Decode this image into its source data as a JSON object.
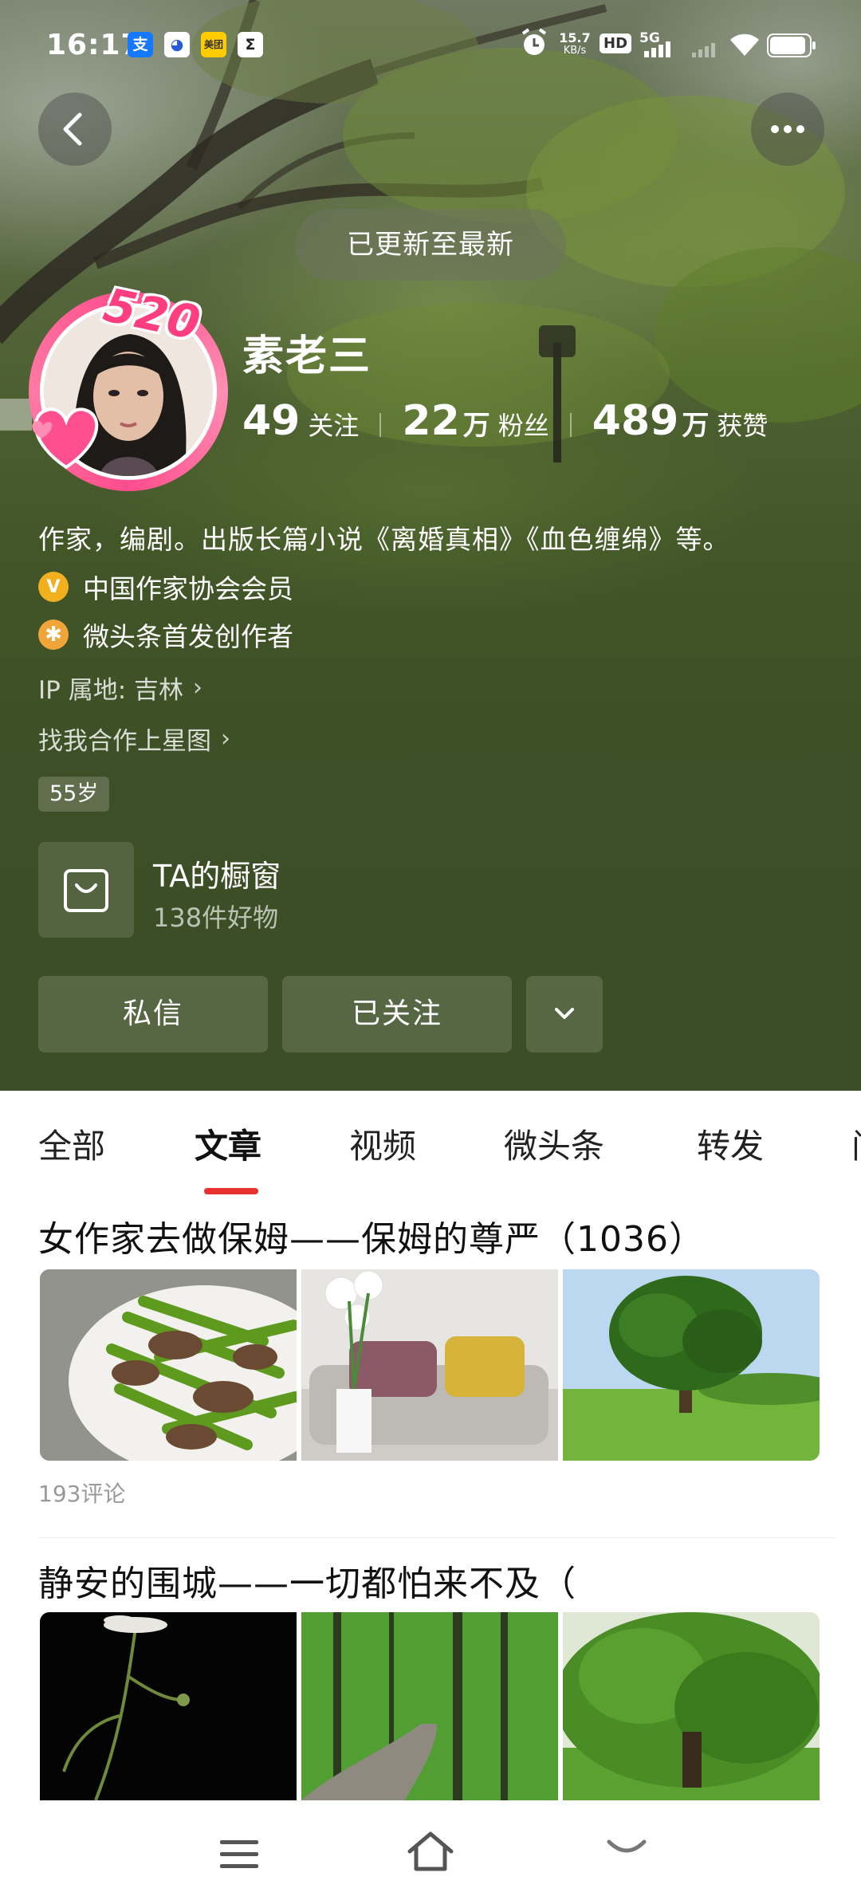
{
  "status_bar": {
    "time": "16:17",
    "app_icons": [
      "alipay-icon",
      "baidu-icon",
      "meituan-icon",
      "sigma-app-icon"
    ],
    "net_speed_value": "15.7",
    "net_speed_unit": "KB/s",
    "hd_label": "HD",
    "signal_label": "5G"
  },
  "toast": "已更新至最新",
  "profile": {
    "name": "素老三",
    "avatar_badge": "520",
    "following_count": "49",
    "following_label": "关注",
    "fans_count": "22",
    "fans_unit": "万",
    "fans_label": "粉丝",
    "likes_count": "489",
    "likes_unit": "万",
    "likes_label": "获赞",
    "bio": "作家，编剧。出版长篇小说《离婚真相》《血色缠绵》等。",
    "verified_1": "中国作家协会会员",
    "verified_2": "微头条首发创作者",
    "ip_location": "IP 属地: 吉林",
    "cooperation_link": "找我合作上星图",
    "age_tag": "55岁"
  },
  "shop": {
    "title": "TA的橱窗",
    "subtitle": "138件好物"
  },
  "actions": {
    "message": "私信",
    "follow": "已关注"
  },
  "tabs": [
    {
      "label": "全部"
    },
    {
      "label": "文章"
    },
    {
      "label": "视频"
    },
    {
      "label": "微头条"
    },
    {
      "label": "转发"
    },
    {
      "label": "问"
    }
  ],
  "active_tab": "文章",
  "articles": [
    {
      "title": "女作家去做保姆——保姆的尊严（1036）",
      "comments": "193评论"
    },
    {
      "title": "静安的围城——一切都怕来不及（"
    }
  ],
  "colors": {
    "accent_red": "#e8302e",
    "avatar_pink": "#ff4d8d",
    "hero_green": "#3c4e25"
  }
}
